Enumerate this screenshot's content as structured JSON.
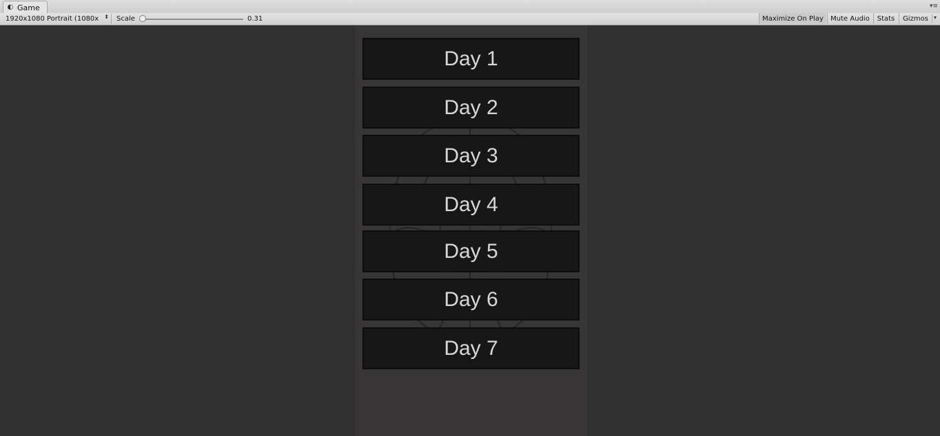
{
  "window": {
    "tab_title": "Game",
    "tab_icon": "unity-game-icon"
  },
  "toolbar": {
    "resolution": "1920x1080 Portrait (1080x",
    "scale_label": "Scale",
    "scale_value": "0.31",
    "scale_fraction": 0.02,
    "maximize_label": "Maximize On Play",
    "mute_label": "Mute Audio",
    "stats_label": "Stats",
    "gizmos_label": "Gizmos"
  },
  "game": {
    "background_image": "brain-illustration",
    "buttons": [
      {
        "label": "Day 1"
      },
      {
        "label": "Day 2"
      },
      {
        "label": "Day 3"
      },
      {
        "label": "Day 4"
      },
      {
        "label": "Day 5"
      },
      {
        "label": "Day 6"
      },
      {
        "label": "Day 7"
      }
    ]
  },
  "colors": {
    "button_bg": "#151515",
    "button_text": "#e4e4e4",
    "canvas_bg": "#373536",
    "viewport_bg": "#303030"
  }
}
